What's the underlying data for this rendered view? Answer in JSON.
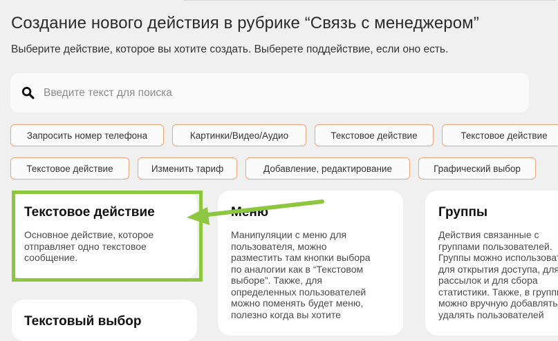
{
  "page": {
    "title": "Создание нового действия в рубрике “Связь с менеджером”",
    "subtitle": "Выберите действие, которое вы хотите создать. Выберете поддействие, если оно есть."
  },
  "search": {
    "placeholder": "Введите текст для поиска",
    "value": "",
    "icon": "search-icon"
  },
  "chips": [
    "Запросить номер телефона",
    "Картинки/Видео/Аудио",
    "Текстовое действие",
    "Текстовое действие",
    "Текстовое действие",
    "Изменить тариф",
    "Добавление, редактирование",
    "Графический выбор"
  ],
  "cards": [
    {
      "title": "Текстовое действие",
      "description": "Основное действие, которое\nотправляет одно текстовое\nсообщение."
    },
    {
      "title": "Меню",
      "description": "Манипуляции с меню для\nпользователя, можно\nразместить там кнопки выбора\nпо аналогии как в “Текстовом\nвыборе”. Также, для\nопределенных пользователей\nможно поменять будет меню,\nполезно когда вы хотите"
    },
    {
      "title": "Группы",
      "description": "Действия связанные с\nгруппами пользователей.\nГруппы можно использовать\nдля открытия доступа, для\nрассылок и для сбора\nстатистики. Также, в группы\nможно вручную добавлять и\nудалять пользователей"
    },
    {
      "title": "Текстовый выбор",
      "description": ""
    }
  ],
  "colors": {
    "chip_border": "#f2a57a",
    "highlight": "#8dc63f",
    "background": "#f0f0f0",
    "card": "#ffffff"
  }
}
